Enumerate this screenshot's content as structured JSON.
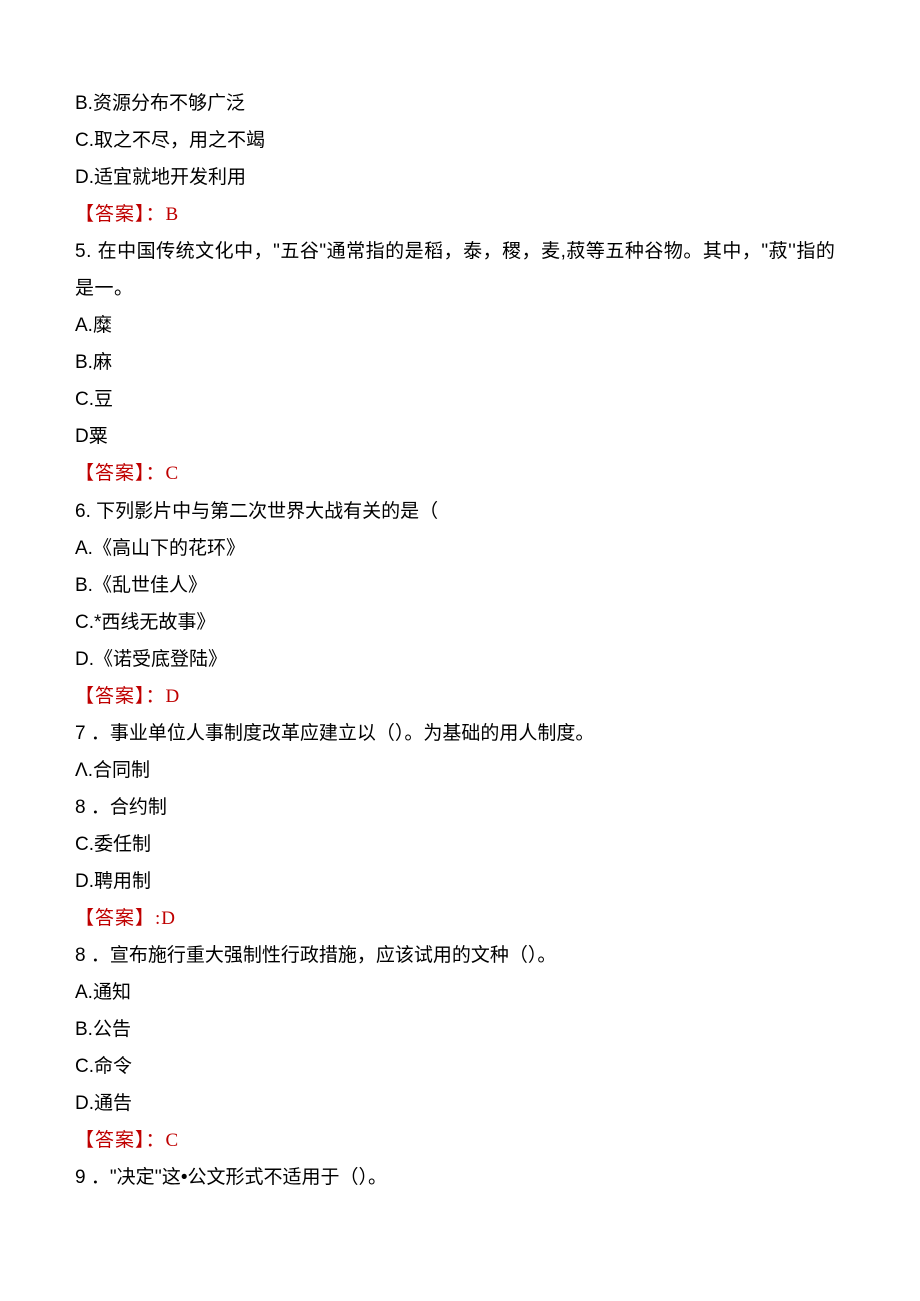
{
  "q4": {
    "optB": "B.资源分布不够广泛",
    "optC": "C.取之不尽，用之不竭",
    "optD": "D.适宜就地开发利用",
    "answer": "【答案】：B"
  },
  "q5": {
    "stem": "5. 在中国传统文化中，\"五谷\"通常指的是稻，泰，稷，麦,菽等五种谷物。其中，\"菽''指的是一。",
    "optA": "A.糜",
    "optB": "B.麻",
    "optC": "C.豆",
    "optD": "D粟",
    "answer": "【答案】：C"
  },
  "q6": {
    "stem": "6. 下列影片中与第二次世界大战有关的是（",
    "optA": "A.《高山下的花环》",
    "optB": "B.《乱世佳人》",
    "optC": "C.*西线无故事》",
    "optD": "D.《诺受底登陆》",
    "answer": "【答案】：D"
  },
  "q7": {
    "stem": "7 ．事业单位人事制度改革应建立以（）。为基础的用人制度。",
    "optA": "Λ.合同制",
    "optB": "8 ．合约制",
    "optC": "C.委任制",
    "optD": "D.聘用制",
    "answer": "【答案】:D"
  },
  "q8": {
    "stem": "8 ．宣布施行重大强制性行政措施，应该试用的文种（）。",
    "optA": "A.通知",
    "optB": "B.公告",
    "optC": "C.命令",
    "optD": "D.通告",
    "answer": "【答案】：C"
  },
  "q9": {
    "stem": "9 ．\"决定''这•公文形式不适用于（）。"
  }
}
